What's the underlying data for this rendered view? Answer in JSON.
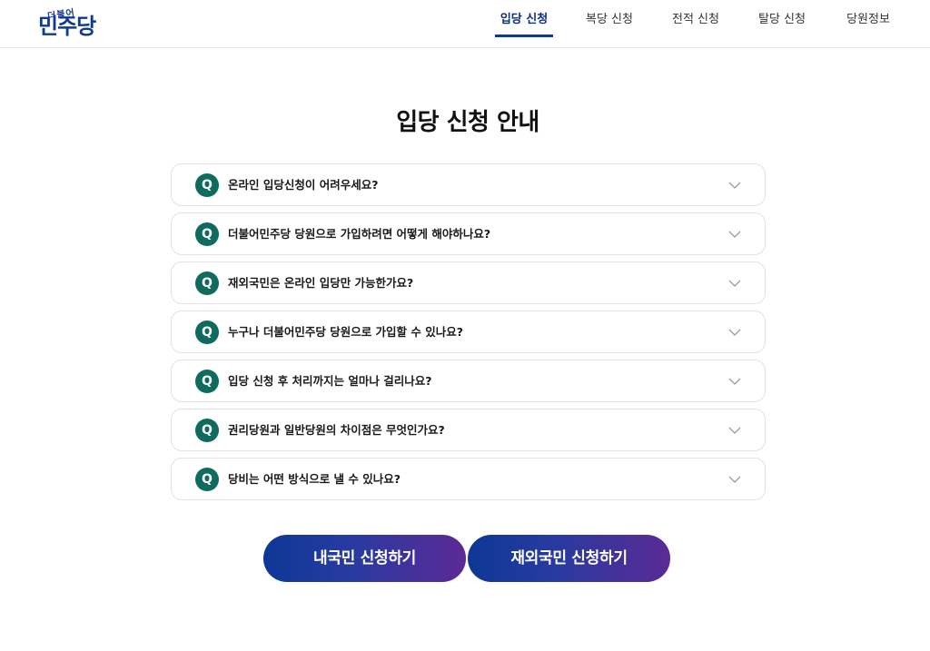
{
  "header": {
    "logo_small": "더불어",
    "logo_main": "민주당",
    "nav": [
      {
        "label": "입당 신청",
        "active": true
      },
      {
        "label": "복당 신청",
        "active": false
      },
      {
        "label": "전적 신청",
        "active": false
      },
      {
        "label": "탈당 신청",
        "active": false
      },
      {
        "label": "당원정보",
        "active": false
      }
    ]
  },
  "main": {
    "title": "입당 신청 안내",
    "faq_badge": "Q",
    "faqs": [
      "온라인 입당신청이 어려우세요?",
      "더불어민주당 당원으로 가입하려면 어떻게 해야하나요?",
      "재외국민은 온라인 입당만 가능한가요?",
      "누구나 더불어민주당 당원으로 가입할 수 있나요?",
      "입당 신청 후 처리까지는 얼마나 걸리나요?",
      "권리당원과 일반당원의 차이점은 무엇인가요?",
      "당비는 어떤 방식으로 낼 수 있나요?"
    ],
    "buttons": {
      "domestic": "내국민 신청하기",
      "overseas": "재외국민 신청하기"
    }
  },
  "colors": {
    "brand_navy": "#0b3a8f",
    "badge_green": "#0e6b5e",
    "button_gradient_start": "#0d3896",
    "button_gradient_end": "#5b2a95"
  },
  "icons": {
    "faq_toggle": "chevron-down-icon"
  }
}
